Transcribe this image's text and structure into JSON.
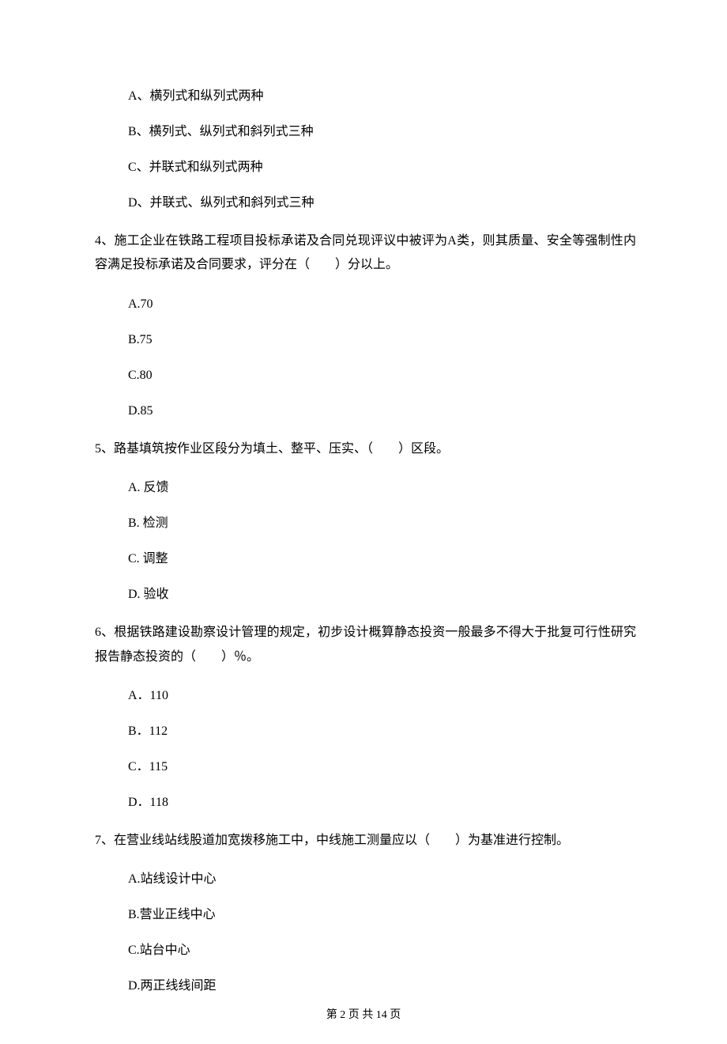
{
  "q3_options": {
    "a": "A、横列式和纵列式两种",
    "b": "B、横列式、纵列式和斜列式三种",
    "c": "C、并联式和纵列式两种",
    "d": "D、并联式、纵列式和斜列式三种"
  },
  "q4": {
    "text": "4、施工企业在铁路工程项目投标承诺及合同兑现评议中被评为A类，则其质量、安全等强制性内容满足投标承诺及合同要求，评分在（　　）分以上。",
    "a": "A.70",
    "b": "B.75",
    "c": "C.80",
    "d": "D.85"
  },
  "q5": {
    "text": "5、路基填筑按作业区段分为填土、整平、压实、（　　）区段。",
    "a": "A. 反馈",
    "b": "B. 检测",
    "c": "C. 调整",
    "d": "D. 验收"
  },
  "q6": {
    "text": "6、根据铁路建设勘察设计管理的规定，初步设计概算静态投资一般最多不得大于批复可行性研究报告静态投资的（　　）％。",
    "a": "A．110",
    "b": "B．112",
    "c": "C．115",
    "d": "D．118"
  },
  "q7": {
    "text": "7、在营业线站线股道加宽拨移施工中，中线施工测量应以（　　）为基准进行控制。",
    "a": "A.站线设计中心",
    "b": "B.营业正线中心",
    "c": "C.站台中心",
    "d": "D.两正线线间距"
  },
  "footer": "第 2 页 共 14 页"
}
